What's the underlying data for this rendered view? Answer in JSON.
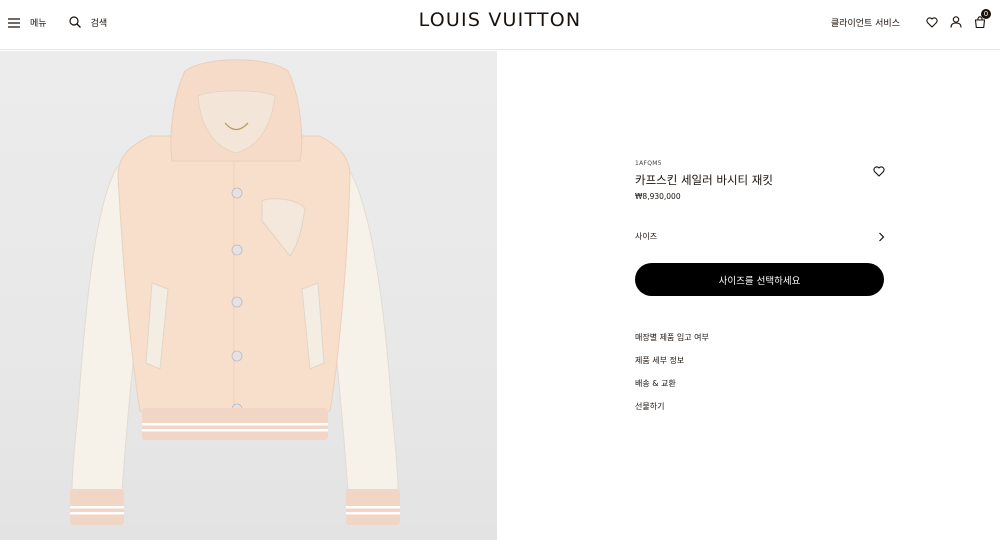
{
  "header": {
    "menu_label": "메뉴",
    "search_label": "검색",
    "logo": "LOUIS VUITTON",
    "client_service_label": "클라이언트 서비스",
    "cart_count": "0"
  },
  "product": {
    "sku": "1AFQM5",
    "name": "카프스킨 세일러 바시티 재킷",
    "price": "₩8,930,000",
    "size_label": "사이즈",
    "select_button_label": "사이즈를 선택하세요",
    "links": [
      "매장별 제품 입고 여부",
      "제품 세부 정보",
      "배송 & 교환",
      "선물하기"
    ]
  },
  "icons": {
    "menu": "hamburger-icon",
    "search": "search-icon",
    "wishlist": "heart-icon",
    "account": "user-icon",
    "cart": "shopping-bag-icon",
    "size_arrow": "chevron-right-icon"
  },
  "colors": {
    "text": "#19110b",
    "button_bg": "#000000",
    "image_bg": "#ebebeb",
    "jacket_body": "#f7dfcc",
    "jacket_sleeve": "#f6f2ea"
  }
}
